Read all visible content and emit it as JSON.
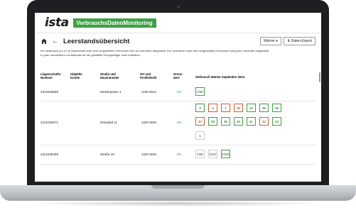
{
  "app": {
    "logo": "ista",
    "title": "VerbrauchsDatenMonitoring"
  },
  "toolbar": {
    "page_title": "Leerstandsübersicht",
    "unit_select": "Wärme ▾",
    "export_button": "⬇ Daten-Export"
  },
  "info": {
    "line1": "Ein Verbrauch pro m² je Nutzeinheit über dem eingestellten Grenzwert wird rot umrandet dargestellt. Ein Verbrauch unter dem eingestellten Grenzwert wird grün umrandet dargestellt.",
    "line2": "In grau umrandeten Leerständen ist der gewählte Energieträger nicht enthalten."
  },
  "columns": [
    "Liegenschafts-Nummer",
    "Objektle Kunde",
    "Straße und Hausnummer",
    "Ort und Postleitzahl",
    "Grenz-wert",
    "Verbrauch Wärme September 2024"
  ],
  "rows": [
    {
      "id": "4312345669",
      "street": "Musterpasse 1",
      "city": "1100 Wien",
      "limit": "5%",
      "boxes": [
        {
          "label": "1/32",
          "status": "green"
        }
      ]
    },
    {
      "id": "4312345671",
      "street": "Dampfad 11",
      "city": "1020 Wien",
      "limit": "5%",
      "boxes": [
        {
          "label": "3",
          "status": "green"
        },
        {
          "label": "4",
          "status": "red"
        },
        {
          "label": "1",
          "status": "red"
        },
        {
          "label": "33",
          "status": "red"
        },
        {
          "label": "34",
          "status": "green"
        },
        {
          "label": "35",
          "status": "green"
        },
        {
          "label": "36",
          "status": "green"
        },
        {
          "label": "37",
          "status": "red"
        },
        {
          "label": "38",
          "status": "green"
        },
        {
          "label": "39",
          "status": "green"
        },
        {
          "label": "40",
          "status": "green"
        },
        {
          "label": "41",
          "status": "green"
        },
        {
          "label": "42",
          "status": "red"
        },
        {
          "label": "43",
          "status": "green"
        },
        {
          "label": "1",
          "status": "plain"
        }
      ]
    },
    {
      "id": "4312345469",
      "street": "Straße 19",
      "city": "1020 Wien",
      "limit": "5%",
      "boxes": [
        {
          "label": "1/26",
          "status": "plain"
        },
        {
          "label": "2/117",
          "status": "plain"
        },
        {
          "label": "2/418",
          "status": "green"
        }
      ]
    }
  ]
}
